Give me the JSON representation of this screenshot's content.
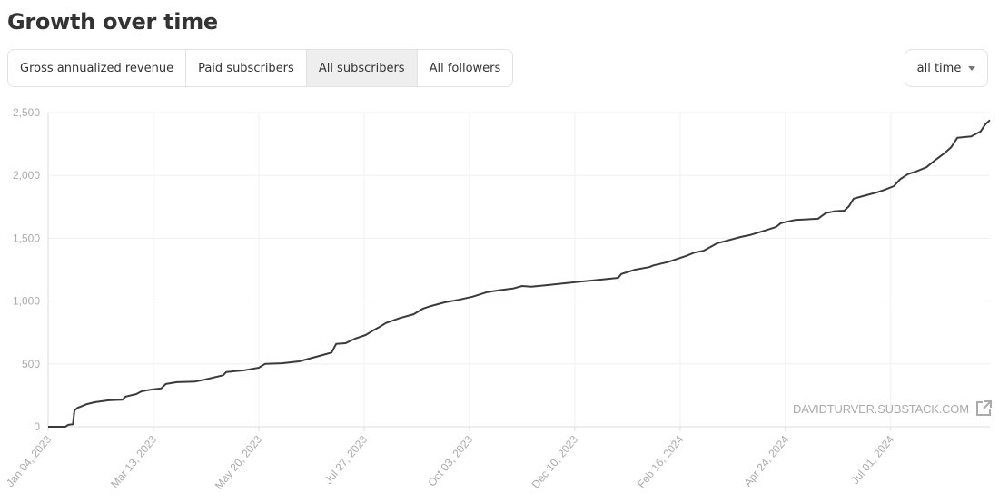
{
  "header": {
    "title": "Growth over time"
  },
  "tabs": [
    {
      "label": "Gross annualized revenue",
      "active": false
    },
    {
      "label": "Paid subscribers",
      "active": false
    },
    {
      "label": "All subscribers",
      "active": true
    },
    {
      "label": "All followers",
      "active": false
    }
  ],
  "range_dropdown": {
    "selected": "all time",
    "icon": "caret-down-icon"
  },
  "watermark": {
    "text": "DAVIDTURVER.SUBSTACK.COM",
    "icon": "external-link-icon"
  },
  "colors": {
    "line": "#3a3a3a",
    "grid": "#f0f0f0",
    "axis": "#dddddd",
    "tick_text": "#aaaaaa",
    "active_tab": "#eeeeee"
  },
  "chart_data": {
    "type": "line",
    "title": "Growth over time",
    "series_name": "All subscribers",
    "xlabel": "",
    "ylabel": "",
    "xlim": [
      "2023-01-04",
      "2024-09-03"
    ],
    "ylim": [
      0,
      2500
    ],
    "yticks": [
      0,
      500,
      1000,
      1500,
      2000,
      2500
    ],
    "ytick_labels": [
      "0",
      "500",
      "1,000",
      "1,500",
      "2,000",
      "2,500"
    ],
    "xticks": [
      "2023-01-04",
      "2023-03-13",
      "2023-05-20",
      "2023-07-27",
      "2023-10-03",
      "2023-12-10",
      "2024-02-16",
      "2024-04-24",
      "2024-07-01"
    ],
    "xtick_labels": [
      "Jan 04, 2023",
      "Mar 13, 2023",
      "May 20, 2023",
      "Jul 27, 2023",
      "Oct 03, 2023",
      "Dec 10, 2023",
      "Feb 16, 2024",
      "Apr 24, 2024",
      "Jul 01, 2024"
    ],
    "grid": true,
    "legend": "none",
    "points": [
      [
        "2023-01-04",
        0
      ],
      [
        "2023-01-15",
        0
      ],
      [
        "2023-01-17",
        15
      ],
      [
        "2023-01-20",
        20
      ],
      [
        "2023-01-21",
        130
      ],
      [
        "2023-01-23",
        150
      ],
      [
        "2023-01-26",
        165
      ],
      [
        "2023-01-29",
        180
      ],
      [
        "2023-02-03",
        195
      ],
      [
        "2023-02-12",
        210
      ],
      [
        "2023-02-21",
        215
      ],
      [
        "2023-02-23",
        240
      ],
      [
        "2023-03-02",
        260
      ],
      [
        "2023-03-05",
        280
      ],
      [
        "2023-03-11",
        295
      ],
      [
        "2023-03-18",
        305
      ],
      [
        "2023-03-21",
        340
      ],
      [
        "2023-03-28",
        355
      ],
      [
        "2023-04-09",
        360
      ],
      [
        "2023-04-15",
        375
      ],
      [
        "2023-04-27",
        410
      ],
      [
        "2023-04-29",
        435
      ],
      [
        "2023-05-11",
        450
      ],
      [
        "2023-05-20",
        470
      ],
      [
        "2023-05-24",
        500
      ],
      [
        "2023-06-04",
        505
      ],
      [
        "2023-06-15",
        520
      ],
      [
        "2023-06-24",
        550
      ],
      [
        "2023-06-30",
        570
      ],
      [
        "2023-07-06",
        590
      ],
      [
        "2023-07-09",
        660
      ],
      [
        "2023-07-15",
        665
      ],
      [
        "2023-07-21",
        700
      ],
      [
        "2023-07-28",
        730
      ],
      [
        "2023-08-01",
        760
      ],
      [
        "2023-08-06",
        795
      ],
      [
        "2023-08-10",
        825
      ],
      [
        "2023-08-19",
        865
      ],
      [
        "2023-08-28",
        895
      ],
      [
        "2023-09-03",
        940
      ],
      [
        "2023-09-08",
        960
      ],
      [
        "2023-09-17",
        990
      ],
      [
        "2023-09-26",
        1010
      ],
      [
        "2023-10-05",
        1035
      ],
      [
        "2023-10-14",
        1070
      ],
      [
        "2023-10-22",
        1085
      ],
      [
        "2023-10-31",
        1100
      ],
      [
        "2023-11-06",
        1120
      ],
      [
        "2023-11-12",
        1115
      ],
      [
        "2023-11-21",
        1125
      ],
      [
        "2023-12-02",
        1140
      ],
      [
        "2023-12-14",
        1155
      ],
      [
        "2023-12-26",
        1170
      ],
      [
        "2024-01-07",
        1185
      ],
      [
        "2024-01-09",
        1215
      ],
      [
        "2024-01-18",
        1250
      ],
      [
        "2024-01-27",
        1270
      ],
      [
        "2024-01-30",
        1285
      ],
      [
        "2024-02-08",
        1310
      ],
      [
        "2024-02-14",
        1335
      ],
      [
        "2024-02-20",
        1360
      ],
      [
        "2024-02-25",
        1385
      ],
      [
        "2024-03-02",
        1400
      ],
      [
        "2024-03-11",
        1460
      ],
      [
        "2024-03-17",
        1480
      ],
      [
        "2024-03-26",
        1510
      ],
      [
        "2024-04-01",
        1525
      ],
      [
        "2024-04-09",
        1555
      ],
      [
        "2024-04-18",
        1590
      ],
      [
        "2024-04-21",
        1620
      ],
      [
        "2024-04-30",
        1645
      ],
      [
        "2024-05-15",
        1655
      ],
      [
        "2024-05-20",
        1700
      ],
      [
        "2024-05-26",
        1715
      ],
      [
        "2024-06-01",
        1720
      ],
      [
        "2024-06-04",
        1755
      ],
      [
        "2024-06-07",
        1815
      ],
      [
        "2024-06-13",
        1835
      ],
      [
        "2024-06-22",
        1865
      ],
      [
        "2024-06-27",
        1885
      ],
      [
        "2024-07-03",
        1915
      ],
      [
        "2024-07-07",
        1970
      ],
      [
        "2024-07-12",
        2010
      ],
      [
        "2024-07-18",
        2035
      ],
      [
        "2024-07-24",
        2065
      ],
      [
        "2024-07-30",
        2125
      ],
      [
        "2024-08-05",
        2180
      ],
      [
        "2024-08-09",
        2225
      ],
      [
        "2024-08-13",
        2300
      ],
      [
        "2024-08-22",
        2310
      ],
      [
        "2024-08-28",
        2350
      ],
      [
        "2024-08-31",
        2405
      ],
      [
        "2024-09-03",
        2440
      ]
    ]
  }
}
